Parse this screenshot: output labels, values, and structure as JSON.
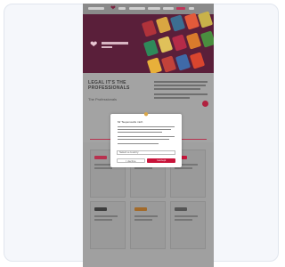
{
  "colors": {
    "hero": "#5a1f3a",
    "accent": "#c8143a",
    "overlay_page": "#9c9c9c"
  },
  "hero": {
    "headline": "LEGAL IT'S THE PROFESSIONALS",
    "subline": "The Professionals"
  },
  "modal": {
    "title": "Mr Tsepenoudis mich",
    "select_label": "Select a country",
    "decline_label": "I decline",
    "accept_label": "I accept",
    "image_icon": "croissant-icon"
  },
  "icons": {
    "logo": "heart-logo-icon",
    "cta": "arrow-circle-icon"
  }
}
